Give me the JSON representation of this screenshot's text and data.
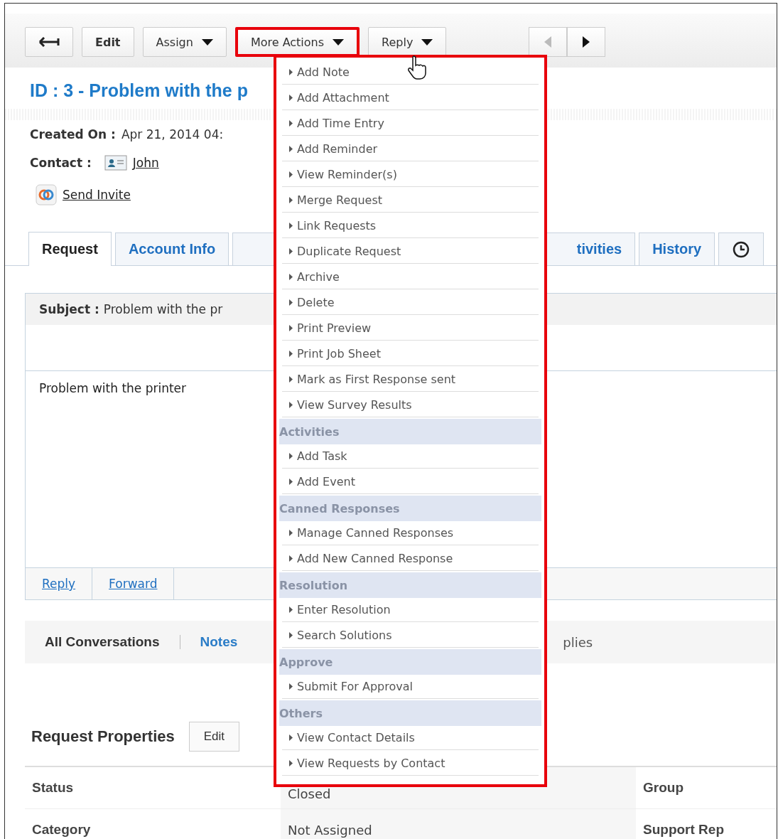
{
  "toolbar": {
    "buttons": [
      {
        "label": "Edit",
        "dropdown": false,
        "highlighted": false
      },
      {
        "label": "Assign",
        "dropdown": true,
        "highlighted": false
      },
      {
        "label": "More Actions",
        "dropdown": true,
        "highlighted": true
      },
      {
        "label": "Reply",
        "dropdown": true,
        "highlighted": false
      }
    ],
    "pager": [
      {
        "disabled": true
      },
      {
        "disabled": false
      }
    ]
  },
  "title": "ID : 3 - Problem with the p",
  "fields": [
    {
      "kind": "text",
      "label": "Created On :",
      "value": "Apr 21, 2014 04:"
    },
    {
      "kind": "contact",
      "label": "Contact :",
      "value": "John"
    }
  ],
  "invite_link": "Send Invite",
  "tabs": [
    {
      "kind": "text",
      "label": "Request",
      "selected": true
    },
    {
      "kind": "text",
      "label": "Account Info",
      "selected": false
    },
    {
      "kind": "partial",
      "label": "tivities",
      "selected": false
    },
    {
      "kind": "text",
      "label": "History",
      "selected": false
    },
    {
      "kind": "clock",
      "selected": false
    }
  ],
  "subject": {
    "label": "Subject :",
    "value": "Problem with the pr"
  },
  "body": "Problem with the printer",
  "reply_links": [
    "Reply",
    "Forward"
  ],
  "conversation_tabs": [
    {
      "label": "All Conversations",
      "selected": true
    },
    {
      "label": "Notes",
      "selected": false
    },
    {
      "label": "plies",
      "selected": false
    }
  ],
  "properties": {
    "title": "Request Properties",
    "edit_button": "Edit",
    "rows": [
      {
        "label": "Status",
        "value": "Closed",
        "label_2": "Group"
      },
      {
        "label": "Category",
        "value": "Not Assigned",
        "label_2": "Support Rep"
      }
    ]
  },
  "menu": [
    {
      "kind": "item",
      "label": "Add Note"
    },
    {
      "kind": "item",
      "label": "Add Attachment"
    },
    {
      "kind": "item",
      "label": "Add Time Entry"
    },
    {
      "kind": "item",
      "label": "Add Reminder"
    },
    {
      "kind": "item",
      "label": "View Reminder(s)"
    },
    {
      "kind": "item",
      "label": "Merge Request"
    },
    {
      "kind": "item",
      "label": "Link Requests"
    },
    {
      "kind": "item",
      "label": "Duplicate Request"
    },
    {
      "kind": "item",
      "label": "Archive"
    },
    {
      "kind": "item",
      "label": "Delete"
    },
    {
      "kind": "item",
      "label": "Print Preview"
    },
    {
      "kind": "item",
      "label": "Print Job Sheet"
    },
    {
      "kind": "item",
      "label": "Mark as First Response sent"
    },
    {
      "kind": "item",
      "label": "View Survey Results"
    },
    {
      "kind": "header",
      "label": "Activities"
    },
    {
      "kind": "item",
      "label": "Add Task"
    },
    {
      "kind": "item",
      "label": "Add Event"
    },
    {
      "kind": "header",
      "label": "Canned Responses"
    },
    {
      "kind": "item",
      "label": "Manage Canned Responses"
    },
    {
      "kind": "item",
      "label": "Add New Canned Response"
    },
    {
      "kind": "header",
      "label": "Resolution"
    },
    {
      "kind": "item",
      "label": "Enter Resolution"
    },
    {
      "kind": "item",
      "label": "Search Solutions"
    },
    {
      "kind": "header",
      "label": "Approve"
    },
    {
      "kind": "item",
      "label": "Submit For Approval"
    },
    {
      "kind": "header",
      "label": "Others"
    },
    {
      "kind": "item",
      "label": "View Contact Details"
    },
    {
      "kind": "item",
      "label": "View Requests by Contact"
    }
  ]
}
